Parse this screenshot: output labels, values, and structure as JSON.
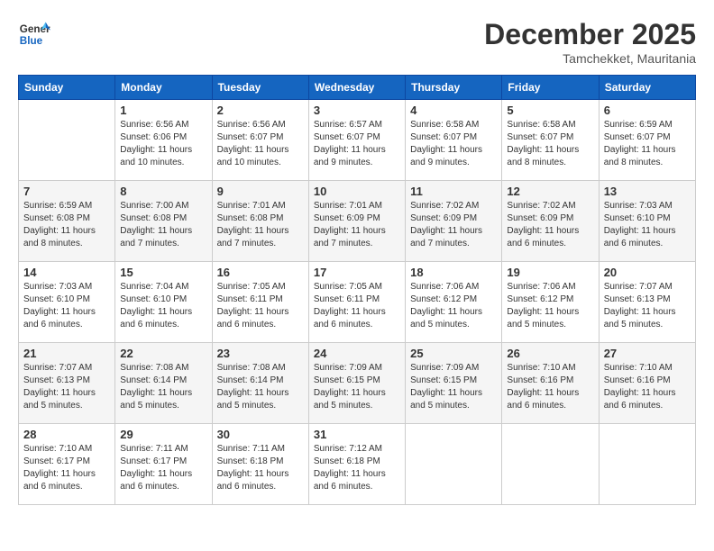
{
  "header": {
    "logo_general": "General",
    "logo_blue": "Blue",
    "month": "December 2025",
    "location": "Tamchekket, Mauritania"
  },
  "days_of_week": [
    "Sunday",
    "Monday",
    "Tuesday",
    "Wednesday",
    "Thursday",
    "Friday",
    "Saturday"
  ],
  "weeks": [
    [
      {
        "day": "",
        "sunrise": "",
        "sunset": "",
        "daylight": ""
      },
      {
        "day": "1",
        "sunrise": "Sunrise: 6:56 AM",
        "sunset": "Sunset: 6:06 PM",
        "daylight": "Daylight: 11 hours and 10 minutes."
      },
      {
        "day": "2",
        "sunrise": "Sunrise: 6:56 AM",
        "sunset": "Sunset: 6:07 PM",
        "daylight": "Daylight: 11 hours and 10 minutes."
      },
      {
        "day": "3",
        "sunrise": "Sunrise: 6:57 AM",
        "sunset": "Sunset: 6:07 PM",
        "daylight": "Daylight: 11 hours and 9 minutes."
      },
      {
        "day": "4",
        "sunrise": "Sunrise: 6:58 AM",
        "sunset": "Sunset: 6:07 PM",
        "daylight": "Daylight: 11 hours and 9 minutes."
      },
      {
        "day": "5",
        "sunrise": "Sunrise: 6:58 AM",
        "sunset": "Sunset: 6:07 PM",
        "daylight": "Daylight: 11 hours and 8 minutes."
      },
      {
        "day": "6",
        "sunrise": "Sunrise: 6:59 AM",
        "sunset": "Sunset: 6:07 PM",
        "daylight": "Daylight: 11 hours and 8 minutes."
      }
    ],
    [
      {
        "day": "7",
        "sunrise": "Sunrise: 6:59 AM",
        "sunset": "Sunset: 6:08 PM",
        "daylight": "Daylight: 11 hours and 8 minutes."
      },
      {
        "day": "8",
        "sunrise": "Sunrise: 7:00 AM",
        "sunset": "Sunset: 6:08 PM",
        "daylight": "Daylight: 11 hours and 7 minutes."
      },
      {
        "day": "9",
        "sunrise": "Sunrise: 7:01 AM",
        "sunset": "Sunset: 6:08 PM",
        "daylight": "Daylight: 11 hours and 7 minutes."
      },
      {
        "day": "10",
        "sunrise": "Sunrise: 7:01 AM",
        "sunset": "Sunset: 6:09 PM",
        "daylight": "Daylight: 11 hours and 7 minutes."
      },
      {
        "day": "11",
        "sunrise": "Sunrise: 7:02 AM",
        "sunset": "Sunset: 6:09 PM",
        "daylight": "Daylight: 11 hours and 7 minutes."
      },
      {
        "day": "12",
        "sunrise": "Sunrise: 7:02 AM",
        "sunset": "Sunset: 6:09 PM",
        "daylight": "Daylight: 11 hours and 6 minutes."
      },
      {
        "day": "13",
        "sunrise": "Sunrise: 7:03 AM",
        "sunset": "Sunset: 6:10 PM",
        "daylight": "Daylight: 11 hours and 6 minutes."
      }
    ],
    [
      {
        "day": "14",
        "sunrise": "Sunrise: 7:03 AM",
        "sunset": "Sunset: 6:10 PM",
        "daylight": "Daylight: 11 hours and 6 minutes."
      },
      {
        "day": "15",
        "sunrise": "Sunrise: 7:04 AM",
        "sunset": "Sunset: 6:10 PM",
        "daylight": "Daylight: 11 hours and 6 minutes."
      },
      {
        "day": "16",
        "sunrise": "Sunrise: 7:05 AM",
        "sunset": "Sunset: 6:11 PM",
        "daylight": "Daylight: 11 hours and 6 minutes."
      },
      {
        "day": "17",
        "sunrise": "Sunrise: 7:05 AM",
        "sunset": "Sunset: 6:11 PM",
        "daylight": "Daylight: 11 hours and 6 minutes."
      },
      {
        "day": "18",
        "sunrise": "Sunrise: 7:06 AM",
        "sunset": "Sunset: 6:12 PM",
        "daylight": "Daylight: 11 hours and 5 minutes."
      },
      {
        "day": "19",
        "sunrise": "Sunrise: 7:06 AM",
        "sunset": "Sunset: 6:12 PM",
        "daylight": "Daylight: 11 hours and 5 minutes."
      },
      {
        "day": "20",
        "sunrise": "Sunrise: 7:07 AM",
        "sunset": "Sunset: 6:13 PM",
        "daylight": "Daylight: 11 hours and 5 minutes."
      }
    ],
    [
      {
        "day": "21",
        "sunrise": "Sunrise: 7:07 AM",
        "sunset": "Sunset: 6:13 PM",
        "daylight": "Daylight: 11 hours and 5 minutes."
      },
      {
        "day": "22",
        "sunrise": "Sunrise: 7:08 AM",
        "sunset": "Sunset: 6:14 PM",
        "daylight": "Daylight: 11 hours and 5 minutes."
      },
      {
        "day": "23",
        "sunrise": "Sunrise: 7:08 AM",
        "sunset": "Sunset: 6:14 PM",
        "daylight": "Daylight: 11 hours and 5 minutes."
      },
      {
        "day": "24",
        "sunrise": "Sunrise: 7:09 AM",
        "sunset": "Sunset: 6:15 PM",
        "daylight": "Daylight: 11 hours and 5 minutes."
      },
      {
        "day": "25",
        "sunrise": "Sunrise: 7:09 AM",
        "sunset": "Sunset: 6:15 PM",
        "daylight": "Daylight: 11 hours and 5 minutes."
      },
      {
        "day": "26",
        "sunrise": "Sunrise: 7:10 AM",
        "sunset": "Sunset: 6:16 PM",
        "daylight": "Daylight: 11 hours and 6 minutes."
      },
      {
        "day": "27",
        "sunrise": "Sunrise: 7:10 AM",
        "sunset": "Sunset: 6:16 PM",
        "daylight": "Daylight: 11 hours and 6 minutes."
      }
    ],
    [
      {
        "day": "28",
        "sunrise": "Sunrise: 7:10 AM",
        "sunset": "Sunset: 6:17 PM",
        "daylight": "Daylight: 11 hours and 6 minutes."
      },
      {
        "day": "29",
        "sunrise": "Sunrise: 7:11 AM",
        "sunset": "Sunset: 6:17 PM",
        "daylight": "Daylight: 11 hours and 6 minutes."
      },
      {
        "day": "30",
        "sunrise": "Sunrise: 7:11 AM",
        "sunset": "Sunset: 6:18 PM",
        "daylight": "Daylight: 11 hours and 6 minutes."
      },
      {
        "day": "31",
        "sunrise": "Sunrise: 7:12 AM",
        "sunset": "Sunset: 6:18 PM",
        "daylight": "Daylight: 11 hours and 6 minutes."
      },
      {
        "day": "",
        "sunrise": "",
        "sunset": "",
        "daylight": ""
      },
      {
        "day": "",
        "sunrise": "",
        "sunset": "",
        "daylight": ""
      },
      {
        "day": "",
        "sunrise": "",
        "sunset": "",
        "daylight": ""
      }
    ]
  ]
}
